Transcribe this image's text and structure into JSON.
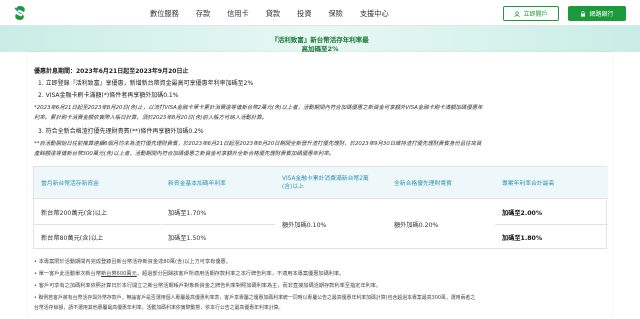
{
  "header": {
    "nav": [
      "數位服務",
      "存款",
      "信用卡",
      "貸款",
      "投資",
      "保險",
      "支援中心"
    ],
    "login_label": "網路銀行",
    "register_label": "立即開戶",
    "brand_color": "#1a9a3a"
  },
  "banner": {
    "line1": "『活利致富』新台幣活存年利率最",
    "line2": "高加碼至2%"
  },
  "content": {
    "period": "優惠計息期間：2023年6月21日起至2023年9月20日止",
    "item1": "1. 立即登錄『活利致富』享優惠，新增新台幣資金最高可享優惠年利率加碼至2%",
    "item2": "2. VISA金融卡刷卡滿額(*)條件者再享額外加碼0.1%",
    "note_star": "*2023年6月21日起至2023年8月20日(含)止，以流打VISA金融卡單卡累計消費達等值新台幣2萬元(含)以上者，活動期間內符合加碼優惠之新資金可享額外VISA金融卡刷卡滿額加碼優惠年",
    "note_star2": "利率。累計刷卡消費金額依實際入帳日計算，須於2023年8月20日(含)前入帳方可納入活動計算。",
    "item3": "3. 符合全新合格渣打優先理財貴賓(**)條件再享額外加碼0.2%",
    "note_dstar": "**自活動開始日往前推算連續6個月均未為渣打優先理財貴賓，於2023年6月21日起至2023年8月20日期間全新晉升渣打優先理財，於2023年9月30日維持渣打優先理財貴賓身份且往來資",
    "note_dstar2": "產餘額達等值新台幣300萬元(含)以上者，活動期間內符合加碼優惠之新資金可享額外全新合格優先理財貴賓加碼優惠年利率。"
  },
  "table": {
    "headers": [
      "當月新台幣活存新資金",
      "新資金基本加碼年利率",
      "VISA金融卡累計消費滿新台幣2萬\n(含)以上",
      "全新合格優先理財貴賓",
      "專案年利率合計最高"
    ],
    "rows": [
      [
        "新台幣200萬元(含)以上",
        "加碼至1.70%",
        "額外加碼0.10%",
        "額外加碼0.20%",
        "加碼至2.00%"
      ],
      [
        "新台幣80萬元(含)以上",
        "加碼至1.50%",
        "",
        "",
        "加碼至1.80%"
      ]
    ]
  },
  "notes": {
    "n1": "• 本專案限於活動期間內完成登錄且新台幣活存新資金達80萬(含)以上方可享有優惠。",
    "n2a": "• 單一客戶此活動單次新台幣",
    "n2u": "新台幣600萬元",
    "n2b": "，超過部分回歸該客戶所適用活期存款利率之本行牌告利率，不適用本專案優惠加碼利率。",
    "n3": "• 客戶可享有之加碼利率依照計算日於本行開立之新台幣活期帳戶對象新資金之牌告利率對照加碼利率為主，而非直接加碼活期存款利率至指定年利率。",
    "n4": "• 聯例若客戶將有台幣活存與外幣存款戶，無論客戶是否選用個人專屬最高優惠利率表，客戶享專屬之優惠加碼利率統一同時以專屬公告之最高優惠年利率加碼計算(包含超過本專案最高300萬，選用兩者之",
    "n5": "  台幣活存餘額，請不選用其他專屬最高優惠年利率，活動加碼利率依實際動態，依本行公告之最高優惠年利率計算。"
  }
}
